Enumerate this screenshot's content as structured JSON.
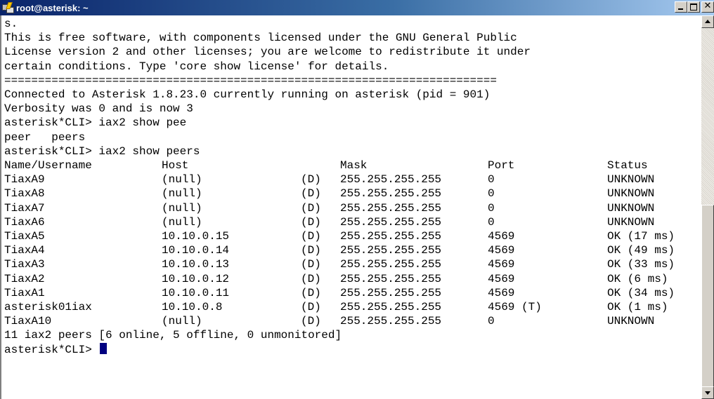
{
  "window": {
    "title": "root@asterisk: ~",
    "icon": "putty-terminal-icon",
    "buttons": {
      "minimize": "minimize",
      "maximize": "maximize",
      "close": "close"
    }
  },
  "terminal": {
    "pre_lines": [
      "s.",
      "This is free software, with components licensed under the GNU General Public",
      "License version 2 and other licenses; you are welcome to redistribute it under",
      "certain conditions. Type 'core show license' for details.",
      "=========================================================================",
      "Connected to Asterisk 1.8.23.0 currently running on asterisk (pid = 901)",
      "Verbosity was 0 and is now 3",
      "asterisk*CLI> iax2 show pee",
      "peer   peers",
      "asterisk*CLI> iax2 show peers"
    ],
    "peers_header": {
      "name": "Name/Username",
      "host": "Host",
      "dyn": "",
      "mask": "Mask",
      "port": "Port",
      "status": "Status"
    },
    "peers": [
      {
        "name": "TiaxA9",
        "host": "(null)",
        "dyn": "(D)",
        "mask": "255.255.255.255",
        "port": "0",
        "status": "UNKNOWN"
      },
      {
        "name": "TiaxA8",
        "host": "(null)",
        "dyn": "(D)",
        "mask": "255.255.255.255",
        "port": "0",
        "status": "UNKNOWN"
      },
      {
        "name": "TiaxA7",
        "host": "(null)",
        "dyn": "(D)",
        "mask": "255.255.255.255",
        "port": "0",
        "status": "UNKNOWN"
      },
      {
        "name": "TiaxA6",
        "host": "(null)",
        "dyn": "(D)",
        "mask": "255.255.255.255",
        "port": "0",
        "status": "UNKNOWN"
      },
      {
        "name": "TiaxA5",
        "host": "10.10.0.15",
        "dyn": "(D)",
        "mask": "255.255.255.255",
        "port": "4569",
        "status": "OK (17 ms)"
      },
      {
        "name": "TiaxA4",
        "host": "10.10.0.14",
        "dyn": "(D)",
        "mask": "255.255.255.255",
        "port": "4569",
        "status": "OK (49 ms)"
      },
      {
        "name": "TiaxA3",
        "host": "10.10.0.13",
        "dyn": "(D)",
        "mask": "255.255.255.255",
        "port": "4569",
        "status": "OK (33 ms)"
      },
      {
        "name": "TiaxA2",
        "host": "10.10.0.12",
        "dyn": "(D)",
        "mask": "255.255.255.255",
        "port": "4569",
        "status": "OK (6 ms)"
      },
      {
        "name": "TiaxA1",
        "host": "10.10.0.11",
        "dyn": "(D)",
        "mask": "255.255.255.255",
        "port": "4569",
        "status": "OK (34 ms)"
      },
      {
        "name": "asterisk01iax",
        "host": "10.10.0.8",
        "dyn": "(D)",
        "mask": "255.255.255.255",
        "port": "4569 (T)",
        "status": "OK (1 ms)"
      },
      {
        "name": "TiaxA10",
        "host": "(null)",
        "dyn": "(D)",
        "mask": "255.255.255.255",
        "port": "0",
        "status": "UNKNOWN"
      }
    ],
    "summary": "11 iax2 peers [6 online, 5 offline, 0 unmonitored]",
    "prompt": "asterisk*CLI> "
  },
  "colors": {
    "titlebar_start": "#0a246a",
    "titlebar_end": "#a6caf0",
    "cursor": "#000080",
    "background": "#ffffff"
  }
}
